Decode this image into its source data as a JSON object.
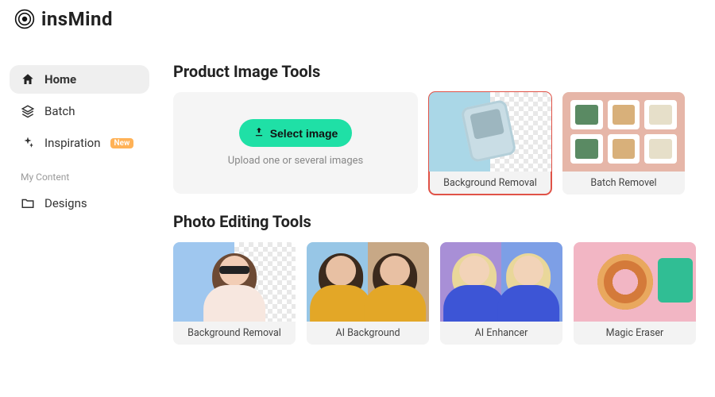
{
  "brand": {
    "name": "insMind"
  },
  "sidebar": {
    "items": [
      {
        "label": "Home",
        "active": true
      },
      {
        "label": "Batch",
        "active": false
      },
      {
        "label": "Inspiration",
        "active": false,
        "badge": "New"
      }
    ],
    "section_label": "My Content",
    "content_items": [
      {
        "label": "Designs"
      }
    ]
  },
  "sections": {
    "product_tools_title": "Product Image Tools",
    "photo_tools_title": "Photo Editing Tools"
  },
  "upload": {
    "button_label": "Select image",
    "hint": "Upload one or several images"
  },
  "product_tools": [
    {
      "label": "Background Removal",
      "highlighted": true
    },
    {
      "label": "Batch Removel",
      "highlighted": false
    }
  ],
  "photo_tools": [
    {
      "label": "Background Removal"
    },
    {
      "label": "AI Background"
    },
    {
      "label": "AI Enhancer"
    },
    {
      "label": "Magic Eraser"
    }
  ]
}
